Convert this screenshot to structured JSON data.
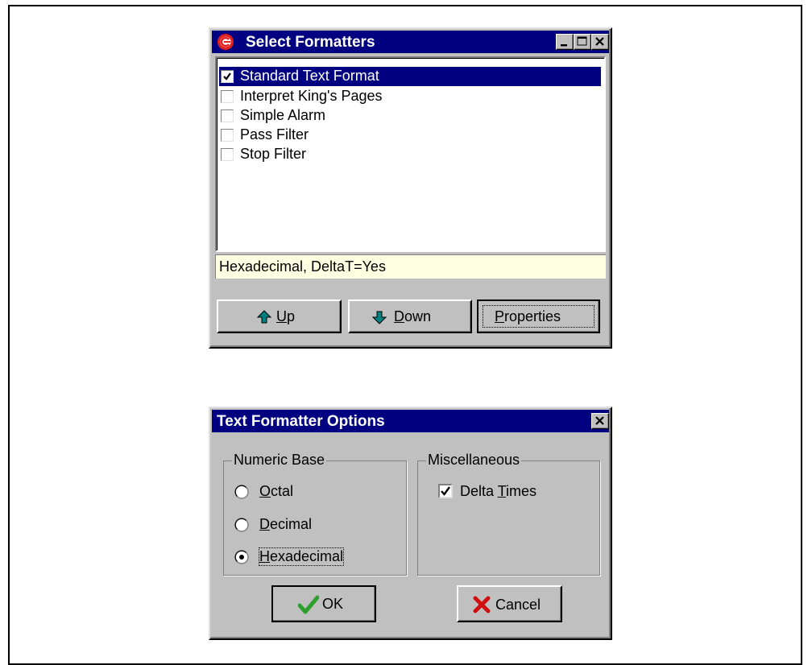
{
  "select_formatters": {
    "title": "Select Formatters",
    "items": [
      {
        "label": "Standard Text Format",
        "checked": true,
        "selected": true
      },
      {
        "label": "Interpret King's Pages",
        "checked": false,
        "selected": false
      },
      {
        "label": "Simple Alarm",
        "checked": false,
        "selected": false
      },
      {
        "label": "Pass Filter",
        "checked": false,
        "selected": false
      },
      {
        "label": "Stop Filter",
        "checked": false,
        "selected": false
      }
    ],
    "status_text": "Hexadecimal, DeltaT=Yes",
    "buttons": {
      "up": {
        "mnemonic": "U",
        "rest": "p"
      },
      "down": {
        "mnemonic": "D",
        "rest": "own"
      },
      "properties": {
        "mnemonic": "P",
        "rest": "roperties"
      }
    }
  },
  "text_formatter_options": {
    "title": "Text Formatter Options",
    "numeric_base": {
      "label": "Numeric Base",
      "options": [
        {
          "mnemonic": "O",
          "rest": "ctal",
          "selected": false
        },
        {
          "mnemonic": "D",
          "rest": "ecimal",
          "selected": false
        },
        {
          "mnemonic": "H",
          "rest": "exadecimal",
          "selected": true
        }
      ]
    },
    "miscellaneous": {
      "label": "Miscellaneous",
      "delta_times": {
        "prefix": "Delta ",
        "mnemonic": "T",
        "rest": "imes",
        "checked": true
      }
    },
    "ok_label": "OK",
    "cancel_label": "Cancel"
  },
  "colors": {
    "titlebar": "#000080",
    "face": "#c0c0c0",
    "status_bg": "#ffffe1",
    "arrow_teal": "#008080",
    "ok_green": "#2e9e2e",
    "cancel_red": "#d01010"
  }
}
